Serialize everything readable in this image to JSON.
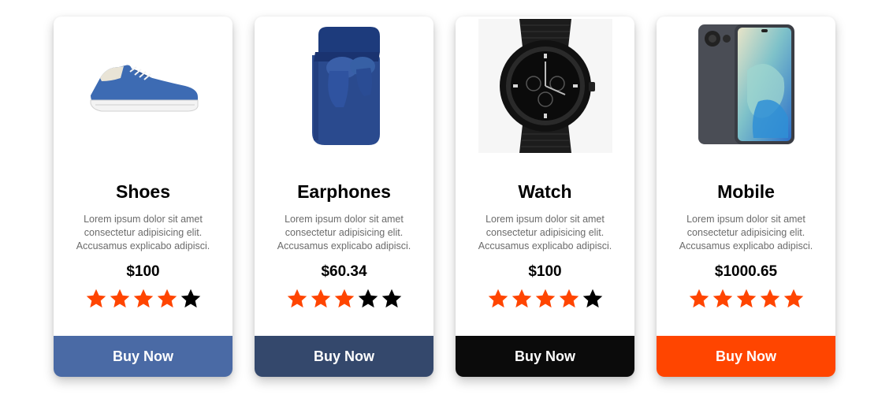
{
  "products": [
    {
      "title": "Shoes",
      "description": "Lorem ipsum dolor sit amet consectetur adipisicing elit. Accusamus explicabo adipisci.",
      "price": "$100",
      "rating": 4,
      "button_label": "Buy Now",
      "button_color": "#4a6aa5",
      "image": "sneaker-image"
    },
    {
      "title": "Earphones",
      "description": "Lorem ipsum dolor sit amet consectetur adipisicing elit. Accusamus explicabo adipisci.",
      "price": "$60.34",
      "rating": 3,
      "button_label": "Buy Now",
      "button_color": "#34486c",
      "image": "earbuds-case-image"
    },
    {
      "title": "Watch",
      "description": "Lorem ipsum dolor sit amet consectetur adipisicing elit. Accusamus explicabo adipisci.",
      "price": "$100",
      "rating": 4,
      "button_label": "Buy Now",
      "button_color": "#0b0b0b",
      "image": "wristwatch-image"
    },
    {
      "title": "Mobile",
      "description": "Lorem ipsum dolor sit amet consectetur adipisicing elit. Accusamus explicabo adipisci.",
      "price": "$1000.65",
      "rating": 5,
      "button_label": "Buy Now",
      "button_color": "#ff4500",
      "image": "smartphone-image"
    }
  ],
  "colors": {
    "star_filled": "#ff4500",
    "star_empty": "#000000"
  }
}
